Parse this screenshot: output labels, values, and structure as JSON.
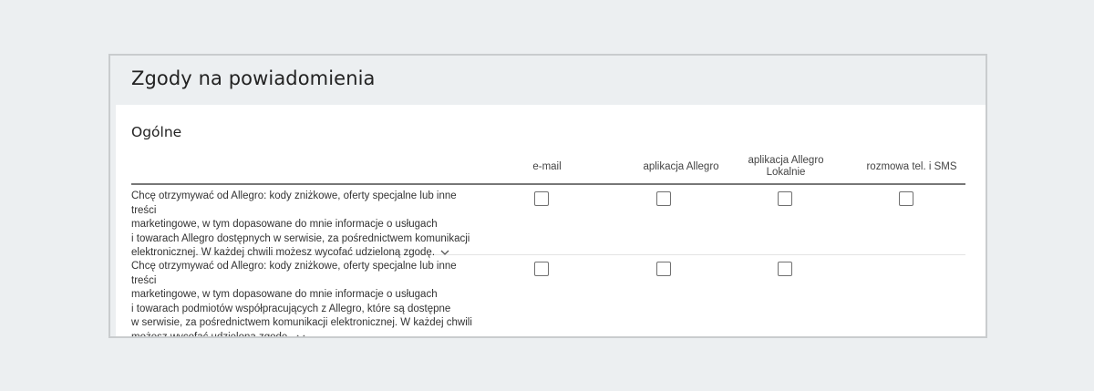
{
  "panel": {
    "title": "Zgody na powiadomienia"
  },
  "section": {
    "title": "Ogólne"
  },
  "columns": [
    "e-mail",
    "aplikacja Allegro",
    "aplikacja Allegro\nLokalnie",
    "rozmowa tel. i SMS"
  ],
  "rows": [
    {
      "text": "Chcę otrzymywać od Allegro: kody zniżkowe, oferty specjalne lub inne treści\nmarketingowe, w tym dopasowane do mnie informacje o usługach\ni towarach Allegro dostępnych w serwisie, za pośrednictwem komunikacji\nelektronicznej. W każdej chwili możesz wycofać udzieloną zgodę.",
      "expand_icon": "chevron-down-icon",
      "checkboxes": [
        false,
        false,
        false,
        false
      ]
    },
    {
      "text": "Chcę otrzymywać od Allegro: kody zniżkowe, oferty specjalne lub inne treści\nmarketingowe, w tym dopasowane do mnie informacje o usługach\ni towarach podmiotów współpracujących z Allegro, które są dostępne\nw serwisie, za pośrednictwem komunikacji elektronicznej. W każdej chwili\nmożesz wycofać udzieloną zgodę.",
      "expand_icon": "chevron-down-icon",
      "checkboxes": [
        false,
        false,
        false
      ]
    }
  ],
  "colors": {
    "page_background": "#eceff1",
    "card_background": "#ffffff",
    "text": "#222222",
    "border": "#c9ccce"
  }
}
